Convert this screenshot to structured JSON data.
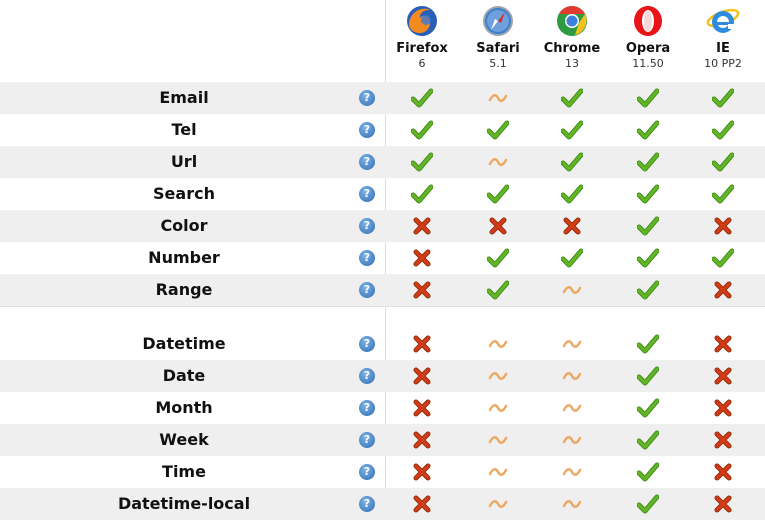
{
  "browsers": [
    {
      "name": "Firefox",
      "version": "6",
      "icon": "firefox-logo-icon",
      "colors": [
        "#f28a1e",
        "#2a5fb8"
      ]
    },
    {
      "name": "Safari",
      "version": "5.1",
      "icon": "safari-logo-icon",
      "colors": [
        "#e9eef4",
        "#3b7fd0"
      ]
    },
    {
      "name": "Chrome",
      "version": "13",
      "icon": "chrome-logo-icon",
      "colors": [
        "#e23a2e",
        "#2e9b43"
      ]
    },
    {
      "name": "Opera",
      "version": "11.50",
      "icon": "opera-logo-icon",
      "colors": [
        "#e8141a",
        "#b00008"
      ]
    },
    {
      "name": "IE",
      "version": "10 PP2",
      "icon": "ie-logo-icon",
      "colors": [
        "#2f8be0",
        "#f2c21a"
      ]
    }
  ],
  "status_colors": {
    "yes": "#63b528",
    "no": "#d33c14",
    "partial": "#f0a65a"
  },
  "help_glyph": "?",
  "rows": [
    {
      "label": "Email",
      "support": [
        "yes",
        "partial",
        "yes",
        "yes",
        "yes"
      ]
    },
    {
      "label": "Tel",
      "support": [
        "yes",
        "yes",
        "yes",
        "yes",
        "yes"
      ]
    },
    {
      "label": "Url",
      "support": [
        "yes",
        "partial",
        "yes",
        "yes",
        "yes"
      ]
    },
    {
      "label": "Search",
      "support": [
        "yes",
        "yes",
        "yes",
        "yes",
        "yes"
      ]
    },
    {
      "label": "Color",
      "support": [
        "no",
        "no",
        "no",
        "yes",
        "no"
      ]
    },
    {
      "label": "Number",
      "support": [
        "no",
        "yes",
        "yes",
        "yes",
        "yes"
      ]
    },
    {
      "label": "Range",
      "support": [
        "no",
        "yes",
        "partial",
        "yes",
        "no"
      ]
    },
    {
      "label": "Datetime",
      "support": [
        "no",
        "partial",
        "partial",
        "yes",
        "no"
      ]
    },
    {
      "label": "Date",
      "support": [
        "no",
        "partial",
        "partial",
        "yes",
        "no"
      ]
    },
    {
      "label": "Month",
      "support": [
        "no",
        "partial",
        "partial",
        "yes",
        "no"
      ]
    },
    {
      "label": "Week",
      "support": [
        "no",
        "partial",
        "partial",
        "yes",
        "no"
      ]
    },
    {
      "label": "Time",
      "support": [
        "no",
        "partial",
        "partial",
        "yes",
        "no"
      ]
    },
    {
      "label": "Datetime-local",
      "support": [
        "no",
        "partial",
        "partial",
        "yes",
        "no"
      ]
    }
  ]
}
